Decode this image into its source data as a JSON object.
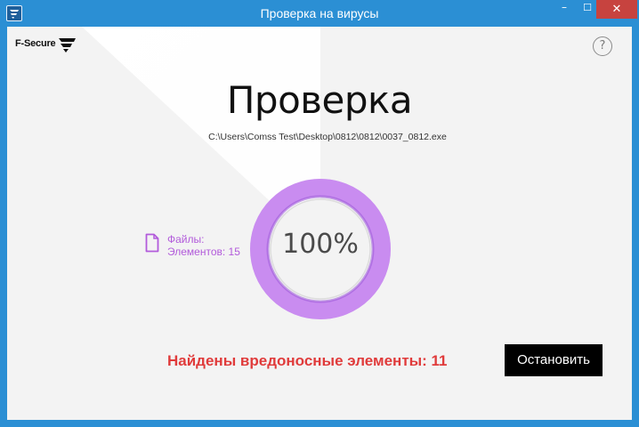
{
  "window": {
    "title": "Проверка на вирусы",
    "minimize_glyph": "–",
    "maximize_glyph": "☐",
    "close_glyph": "✕",
    "app_icon": "f-secure-app-icon"
  },
  "logo": {
    "text": "F-Secure"
  },
  "help": {
    "label": "?"
  },
  "scan": {
    "heading": "Проверка",
    "current_path": "C:\\Users\\Comss Test\\Desktop\\0812\\0812\\0037_0812.exe",
    "progress_percent_label": "100%",
    "progress": 1.0,
    "files_label": "Файлы:",
    "items_label": "Элементов: 15",
    "result_text": "Найдены вредоносные элементы: 11"
  },
  "actions": {
    "stop_label": "Остановить"
  },
  "colors": {
    "window_frame": "#2b8fd4",
    "ring_accent": "#c98cf0",
    "ring_outer": "#b77ae6",
    "ring_inner": "#9b55d9",
    "alert": "#e03b3b",
    "files_text": "#b25bdb",
    "button_bg": "#000000"
  }
}
